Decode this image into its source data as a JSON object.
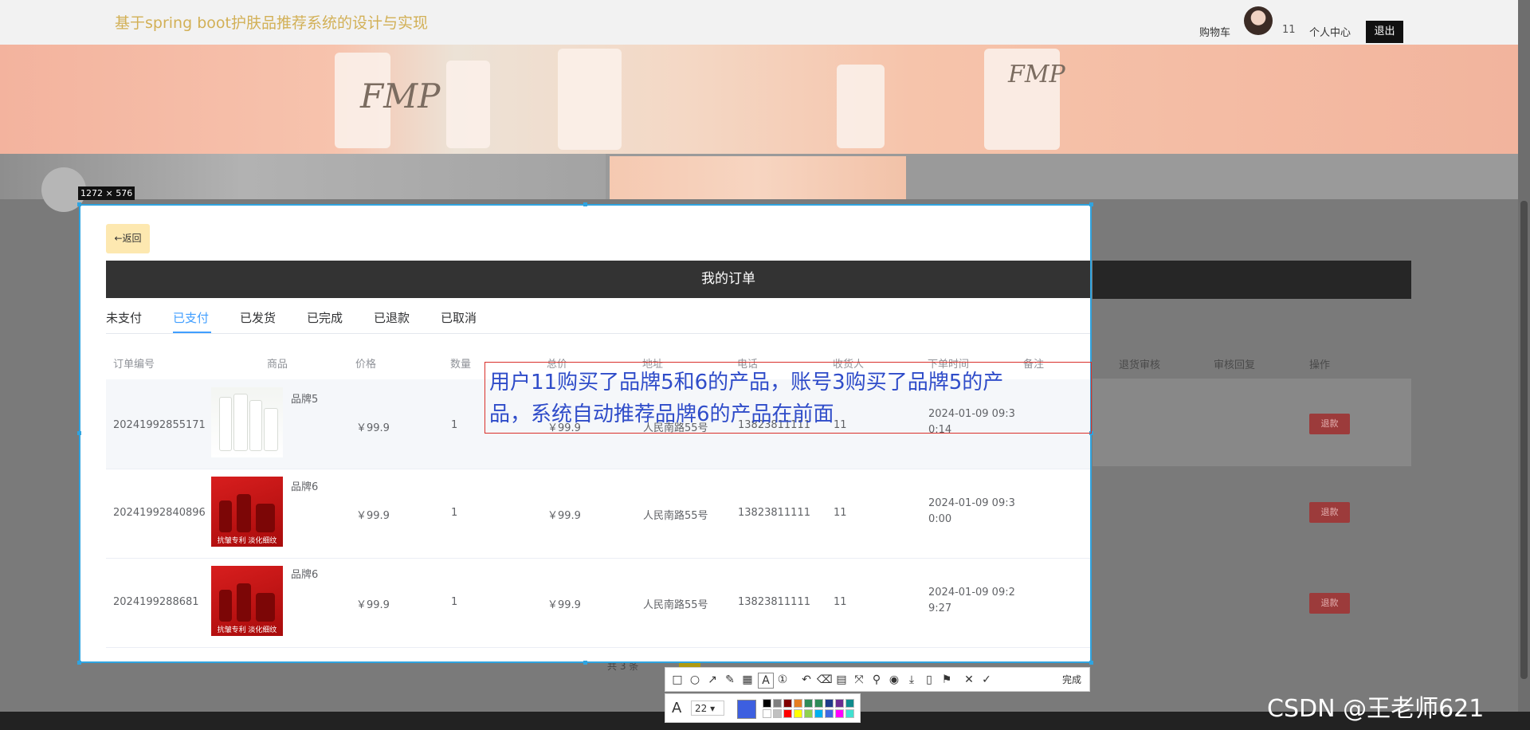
{
  "header": {
    "site_title": "基于spring boot护肤品推荐系统的设计与实现",
    "cart": "购物车",
    "username": "11",
    "user_center": "个人中心",
    "logout": "退出"
  },
  "banner": {
    "brand_logo": "FMP"
  },
  "screenshot_tool": {
    "size_label": "1272 × 576",
    "done_label": "完成",
    "font_size": "22",
    "current_color": "#3d5fe0",
    "palette_row1": [
      "#000000",
      "#808080",
      "#800000",
      "#e67e22",
      "#2e8b57",
      "#2e8b57",
      "#1e3a8a",
      "#6b2c91",
      "#0f8b8d"
    ],
    "palette_row2": [
      "#ffffff",
      "#c0c0c0",
      "#ff0000",
      "#ffff00",
      "#8fd14f",
      "#00b0f0",
      "#4169e1",
      "#ff00ff",
      "#40e0d0"
    ]
  },
  "orders": {
    "back_button": "←返回",
    "title": "我的订单",
    "tabs": [
      "未支付",
      "已支付",
      "已发货",
      "已完成",
      "已退款",
      "已取消"
    ],
    "active_tab": "已支付",
    "columns": [
      "订单编号",
      "商品",
      "价格",
      "数量",
      "总价",
      "地址",
      "电话",
      "收货人",
      "下单时间",
      "备注",
      "退货审核",
      "审核回复",
      "操作"
    ],
    "rows": [
      {
        "order_no": "20241992855171",
        "product": "品牌5",
        "price": "￥99.9",
        "qty": "1",
        "total": "￥99.9",
        "address": "人民南路55号",
        "phone": "13823811111",
        "receiver": "11",
        "time_line1": "2024-01-09 09:3",
        "time_line2": "0:14",
        "action": "退款"
      },
      {
        "order_no": "20241992840896",
        "product": "品牌6",
        "price": "￥99.9",
        "qty": "1",
        "total": "￥99.9",
        "address": "人民南路55号",
        "phone": "13823811111",
        "receiver": "11",
        "time_line1": "2024-01-09 09:3",
        "time_line2": "0:00",
        "action": "退款"
      },
      {
        "order_no": "2024199288681",
        "product": "品牌6",
        "price": "￥99.9",
        "qty": "1",
        "total": "￥99.9",
        "address": "人民南路55号",
        "phone": "13823811111",
        "receiver": "11",
        "time_line1": "2024-01-09 09:2",
        "time_line2": "9:27",
        "action": "退款"
      }
    ],
    "pagination_total": "共 3 条"
  },
  "annotation": {
    "line1": "用户11购买了品牌5和6的产品，账号3购买了品牌5的产",
    "line2": "品，系统自动推荐品牌6的产品在前面",
    "color": "#2f4cc9"
  },
  "watermark": "CSDN @王老师621"
}
